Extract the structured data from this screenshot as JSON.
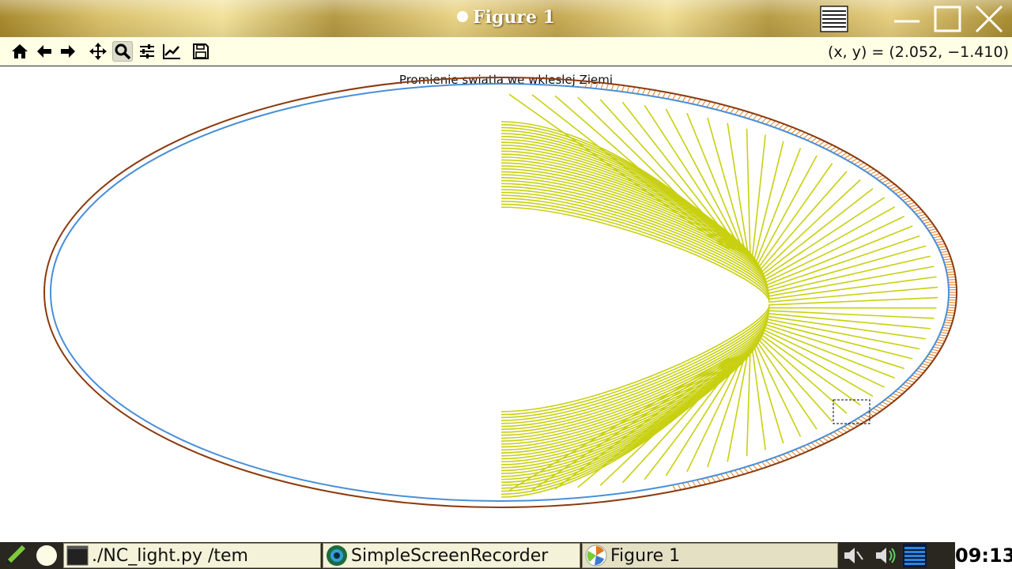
{
  "window": {
    "title": "Figure 1"
  },
  "toolbar": {
    "buttons": [
      "home",
      "back",
      "forward",
      "pan",
      "zoom",
      "configure-subplots",
      "edit-axis",
      "save"
    ],
    "coords": "(x, y) = (2.052, −1.410)",
    "active": "zoom"
  },
  "figure": {
    "title": "Promienie swiatla we wkleslej Ziemi"
  },
  "chart_data": {
    "type": "line",
    "title": "Promienie swiatla we wkleslej Ziemi",
    "xlabel": "",
    "ylabel": "",
    "grid": false,
    "series_descriptions": [
      {
        "kind": "outer-ellipse",
        "color": "#8b3a0f"
      },
      {
        "kind": "inner-ellipse",
        "color": "#4a8fd8"
      },
      {
        "kind": "light-rays",
        "color": "#c8d010",
        "count": 60
      },
      {
        "kind": "edge-hatching",
        "color": "#e07a1a"
      }
    ]
  },
  "taskbar": {
    "tasks": [
      {
        "label": "./NC_light.py /tem"
      },
      {
        "label": "SimpleScreenRecorder"
      },
      {
        "label": "Figure 1"
      }
    ],
    "clock": "09:13"
  },
  "colors": {
    "toolbar_bg": "#ffffe6",
    "outer_ellipse": "#8b3a0f",
    "inner_ellipse": "#4a8fd8",
    "rays": "#c8d010",
    "hatch": "#e07a1a"
  }
}
